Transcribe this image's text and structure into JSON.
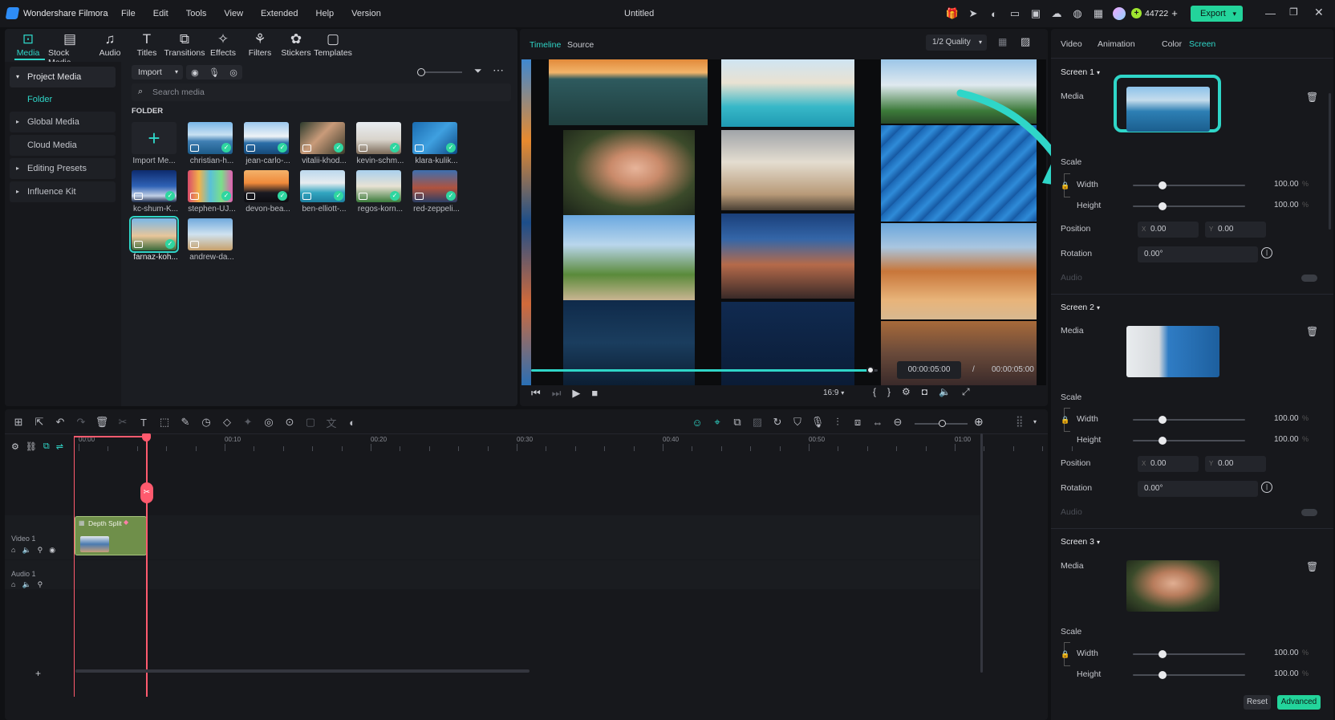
{
  "app": {
    "name": "Wondershare Filmora",
    "project_title": "Untitled",
    "credits": "44722",
    "export_label": "Export"
  },
  "menu": [
    "File",
    "Edit",
    "Tools",
    "View",
    "Extended",
    "Help",
    "Version"
  ],
  "toolbar": [
    {
      "label": "Media",
      "icon": "media-icon"
    },
    {
      "label": "Stock Media",
      "icon": "stock-media-icon"
    },
    {
      "label": "Audio",
      "icon": "audio-icon"
    },
    {
      "label": "Titles",
      "icon": "titles-icon"
    },
    {
      "label": "Transitions",
      "icon": "transitions-icon"
    },
    {
      "label": "Effects",
      "icon": "effects-icon"
    },
    {
      "label": "Filters",
      "icon": "filters-icon"
    },
    {
      "label": "Stickers",
      "icon": "stickers-icon"
    },
    {
      "label": "Templates",
      "icon": "templates-icon"
    }
  ],
  "sidebar": {
    "items": [
      "Project Media",
      "Folder",
      "Global Media",
      "Cloud Media",
      "Editing Presets",
      "Influence Kit"
    ]
  },
  "media": {
    "import_label": "Import",
    "search_placeholder": "Search media",
    "folder_heading": "FOLDER",
    "items": [
      "Import Me...",
      "christian-h...",
      "jean-carlo-...",
      "vitalii-khod...",
      "kevin-schm...",
      "klara-kulik...",
      "kc-shum-K...",
      "stephen-UJ...",
      "devon-bea...",
      "ben-elliott-...",
      "regos-korn...",
      "red-zeppeli...",
      "farnaz-koh...",
      "andrew-da..."
    ]
  },
  "preview": {
    "tabs": [
      "Timeline",
      "Source"
    ],
    "quality": "1/2 Quality",
    "current_time": "00:00:05:00",
    "separator": "/",
    "total_time": "00:00:05:00",
    "aspect": "16:9",
    "progress": 0.98
  },
  "right_panel": {
    "tabs": [
      "Video",
      "Animation",
      "Color",
      "Screen"
    ],
    "screens": [
      {
        "title": "Screen 1",
        "media_label": "Media",
        "scale_label": "Scale",
        "width_label": "Width",
        "width_value": "100.00",
        "height_label": "Height",
        "height_value": "100.00",
        "percent": "%",
        "position_label": "Position",
        "x_label": "X",
        "x_value": "0.00",
        "y_label": "Y",
        "y_value": "0.00",
        "rotation_label": "Rotation",
        "rotation_value": "0.00°",
        "audio_label": "Audio"
      },
      {
        "title": "Screen 2",
        "media_label": "Media",
        "scale_label": "Scale",
        "width_label": "Width",
        "width_value": "100.00",
        "height_label": "Height",
        "height_value": "100.00",
        "percent": "%",
        "position_label": "Position",
        "x_label": "X",
        "x_value": "0.00",
        "y_label": "Y",
        "y_value": "0.00",
        "rotation_label": "Rotation",
        "rotation_value": "0.00°",
        "audio_label": "Audio"
      },
      {
        "title": "Screen 3",
        "media_label": "Media",
        "scale_label": "Scale",
        "width_label": "Width",
        "width_value": "100.00",
        "height_label": "Height",
        "height_value": "100.00",
        "percent": "%"
      }
    ],
    "reset_label": "Reset",
    "advanced_label": "Advanced"
  },
  "timeline": {
    "ruler": [
      "00:00",
      "00:10",
      "00:20",
      "00:30",
      "00:40",
      "00:50",
      "01:00"
    ],
    "tracks": [
      "Video 1",
      "Audio 1"
    ],
    "clip_label": "Depth Split"
  },
  "colors": {
    "accent": "#2fd6c8",
    "export": "#23d49b",
    "playhead": "#ff5a6e",
    "clip": "#6f8f4a",
    "highlight": "#2fd6c8"
  }
}
